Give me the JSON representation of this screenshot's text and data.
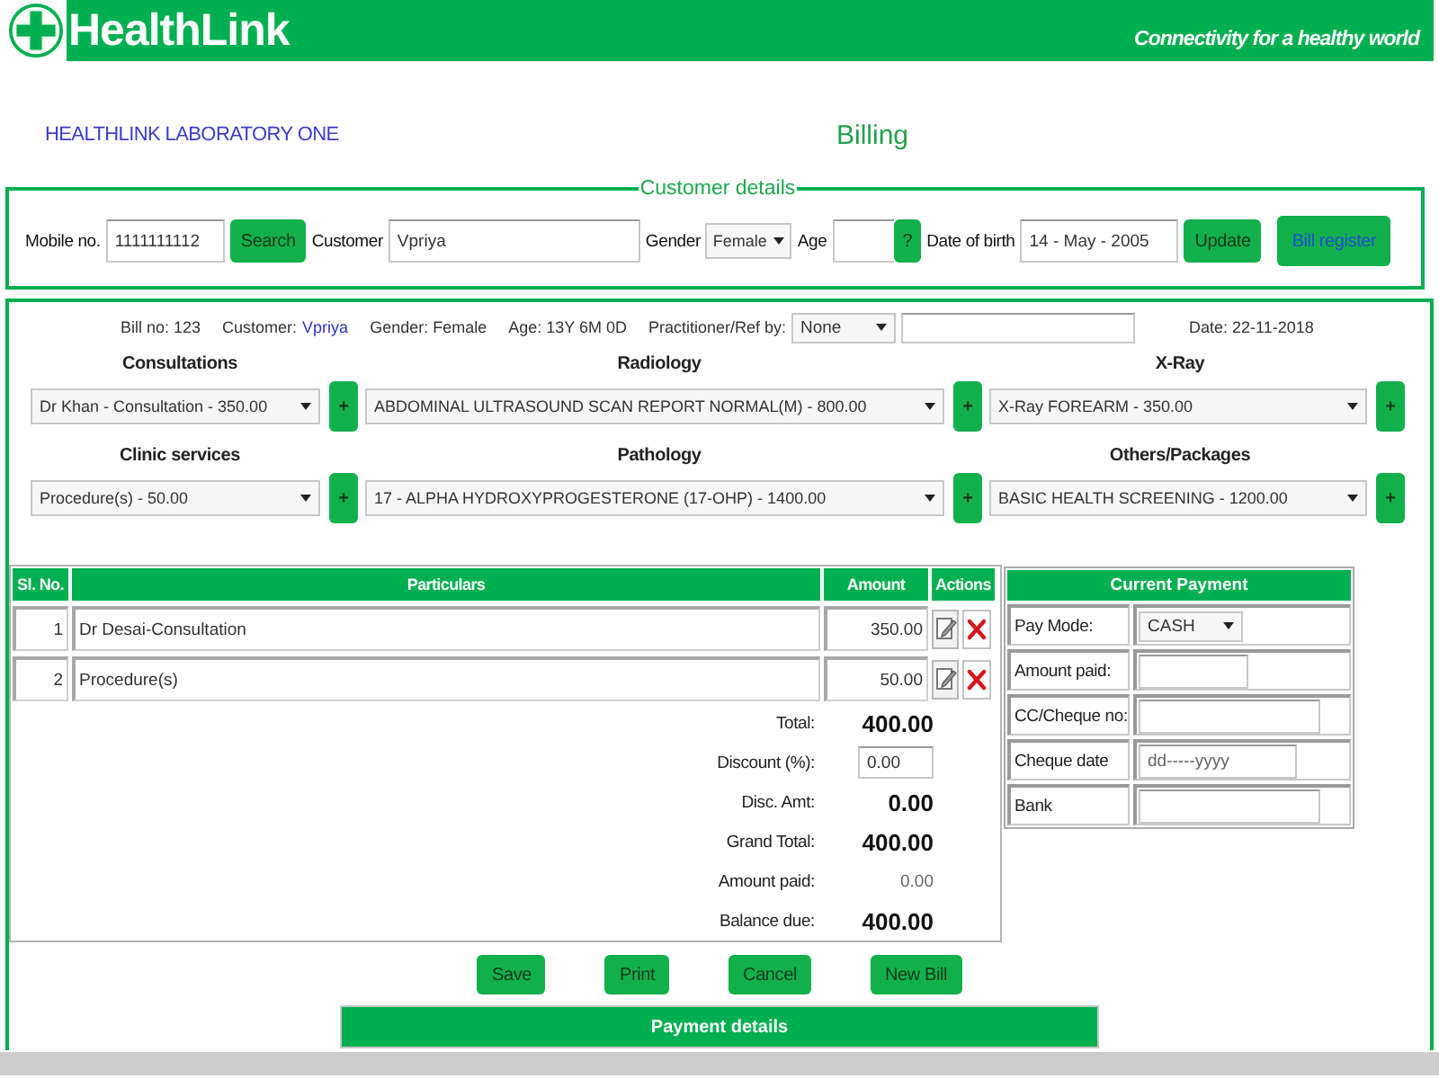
{
  "header": {
    "brand": "HealthLink",
    "tagline": "Connectivity for a healthy world"
  },
  "page": {
    "organization": "HEALTHLINK LABORATORY ONE",
    "title": "Billing"
  },
  "customer_details": {
    "legend": "Customer details",
    "mobile": {
      "label": "Mobile no.",
      "value": "1111111112"
    },
    "search_button": "Search",
    "customer": {
      "label": "Customer",
      "value": "Vpriya"
    },
    "gender": {
      "label": "Gender",
      "value": "Female"
    },
    "age": {
      "label": "Age"
    },
    "age_button": "?",
    "date_of_birth": {
      "label": "Date of birth",
      "value": "14 - May - 2005"
    },
    "update_button": "Update",
    "bill_register_button": "Bill register"
  },
  "bill_info": {
    "bill_no": "Bill no: 123",
    "customer_label": "Customer:",
    "customer_name": "Vpriya",
    "gender": "Gender: Female",
    "age": "Age: 13Y 6M 0D",
    "practitioner_label": "Practitioner/Ref by:",
    "practitioner": "None",
    "date": "Date: 22-11-2018"
  },
  "services": [
    {
      "heading": "Consultations",
      "value": "Dr Khan - Consultation - 350.00",
      "add_button": "+"
    },
    {
      "heading": "Radiology",
      "value": "ABDOMINAL ULTRASOUND SCAN REPORT NORMAL(M) - 800.00",
      "add_button": "+"
    },
    {
      "heading": "X-Ray",
      "value": "X-Ray FOREARM - 350.00",
      "add_button": "+"
    },
    {
      "heading": "Clinic services",
      "value": "Procedure(s) - 50.00",
      "add_button": "+"
    },
    {
      "heading": "Pathology",
      "value": "17 - ALPHA HYDROXYPROGESTERONE (17-OHP) - 1400.00",
      "add_button": "+"
    },
    {
      "heading": "Others/Packages",
      "value": "BASIC HEALTH SCREENING - 1200.00",
      "add_button": "+"
    }
  ],
  "items_table": {
    "columns": [
      "Sl. No.",
      "Particulars",
      "Amount",
      "Actions"
    ],
    "rows": [
      {
        "sl_no": "1",
        "particulars": "Dr Desai-Consultation",
        "amount": "350.00"
      },
      {
        "sl_no": "2",
        "particulars": "Procedure(s)",
        "amount": "50.00"
      }
    ]
  },
  "totals": [
    {
      "label": "Total:",
      "value": "400.00",
      "kind": "strong"
    },
    {
      "label": "Discount (%):",
      "value": "0.00",
      "kind": "field"
    },
    {
      "label": "Disc. Amt:",
      "value": "0.00",
      "kind": "strong"
    },
    {
      "label": "Grand Total:",
      "value": "400.00",
      "kind": "strong"
    },
    {
      "label": "Amount paid:",
      "value": "0.00",
      "kind": "plain"
    },
    {
      "label": "Balance due:",
      "value": "400.00",
      "kind": "strong"
    }
  ],
  "current_payment": {
    "title": "Current Payment",
    "fields": [
      {
        "label": "Pay Mode:",
        "kind": "select",
        "value": "CASH"
      },
      {
        "label": "Amount paid:",
        "kind": "input"
      },
      {
        "label": "CC/Cheque no:",
        "kind": "input"
      },
      {
        "label": "Cheque date",
        "kind": "date",
        "placeholder": "dd-----yyyy"
      },
      {
        "label": "Bank",
        "kind": "input"
      }
    ]
  },
  "actions": [
    "Save",
    "Print",
    "Cancel",
    "New Bill"
  ],
  "payment_details": "Payment details"
}
